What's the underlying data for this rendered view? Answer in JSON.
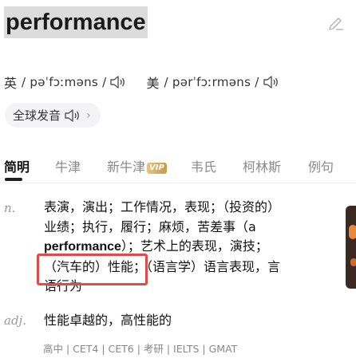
{
  "headword": "performance",
  "pronunciations": [
    {
      "region": "英",
      "ipa": "/ pəˈfɔːməns /"
    },
    {
      "region": "美",
      "ipa": "/ pərˈfɔːrməns /"
    }
  ],
  "global_pronunciation_label": "全球发音",
  "tabs": [
    {
      "label": "简明",
      "active": true
    },
    {
      "label": "牛津"
    },
    {
      "label": "新牛津",
      "badge": "VIP"
    },
    {
      "label": "韦氏"
    },
    {
      "label": "柯林斯"
    },
    {
      "label": "例句"
    }
  ],
  "definitions": [
    {
      "pos": "n.",
      "line1": "表演，演出；工作情况，表现；（投资的）",
      "line2": "业绩；执行，履行；麻烦，苦差事（a",
      "line3_en": "performance",
      "line3_rest": "）；艺术上的表现，演技；",
      "line4": "（汽车的）性能；（语言学）语言表现，言",
      "line5": "语行为"
    },
    {
      "pos": "adj.",
      "text": "性能卓越的，高性能的"
    }
  ],
  "exam_tags": "高中 | CET4 | CET6 | 考研 | IELTS | GMAT",
  "colors": {
    "highlight_border": "#e24a4a",
    "vip_gold": "#c79a45"
  }
}
